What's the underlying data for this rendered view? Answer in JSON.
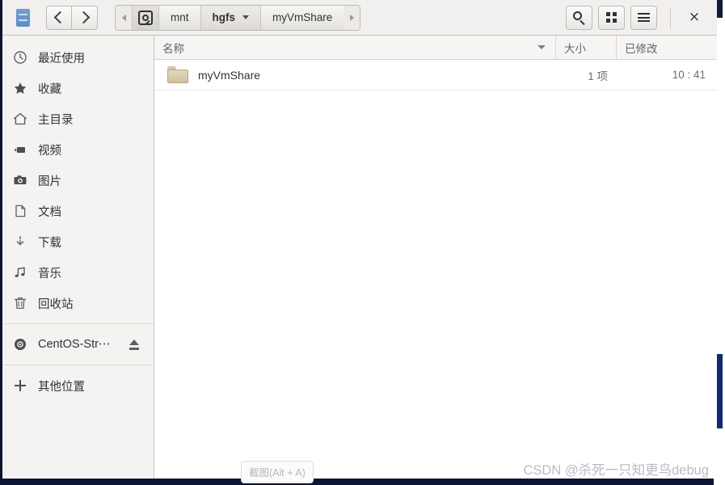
{
  "window": {
    "app_icon": "file-cabinet-icon"
  },
  "header": {
    "nav": {
      "back_label": "‹",
      "forward_label": "›"
    },
    "breadcrumb": {
      "left_arrow": "◂",
      "right_arrow": "▸",
      "items": [
        {
          "label": "",
          "icon": "device-disk-icon",
          "current": false
        },
        {
          "label": "mnt",
          "icon": "",
          "current": false
        },
        {
          "label": "hgfs",
          "icon": "",
          "current": true
        },
        {
          "label": "myVmShare",
          "icon": "",
          "current": false
        }
      ]
    },
    "actions": [
      {
        "name": "search-button",
        "icon": "search-icon"
      },
      {
        "name": "view-grid-button",
        "icon": "grid-icon"
      },
      {
        "name": "main-menu-button",
        "icon": "hamburger-menu-icon"
      }
    ],
    "close_label": "×"
  },
  "sidebar": {
    "items": [
      {
        "label": "最近使用",
        "icon": "clock-icon"
      },
      {
        "label": "收藏",
        "icon": "star-icon"
      },
      {
        "label": "主目录",
        "icon": "home-icon"
      },
      {
        "label": "视频",
        "icon": "video-camera-icon"
      },
      {
        "label": "图片",
        "icon": "camera-icon"
      },
      {
        "label": "文档",
        "icon": "document-icon"
      },
      {
        "label": "下载",
        "icon": "download-icon"
      },
      {
        "label": "音乐",
        "icon": "music-note-icon"
      },
      {
        "label": "回收站",
        "icon": "trash-icon"
      }
    ],
    "devices": [
      {
        "label": "CentOS-Str⋯",
        "icon": "optical-disc-icon",
        "eject": "eject-icon"
      }
    ],
    "other": [
      {
        "label": "其他位置",
        "icon": "plus-icon"
      }
    ]
  },
  "file_list": {
    "columns": [
      {
        "key": "name",
        "label": "名称",
        "sorted": true,
        "sort_dir": "descending"
      },
      {
        "key": "size",
        "label": "大小",
        "sorted": false,
        "sort_dir": ""
      },
      {
        "key": "modified",
        "label": "已修改",
        "sorted": false,
        "sort_dir": ""
      }
    ],
    "rows": [
      {
        "name": "myVmShare",
        "icon": "folder-icon",
        "size": "1 项",
        "modified": "10 : 41"
      }
    ]
  },
  "overlays": {
    "screenshot_tooltip": "截图(Alt + A)",
    "watermark": "CSDN @杀死一只知更鸟debug"
  },
  "colors": {
    "desktop": "#0c1333",
    "headerbar": "#f1f0ee",
    "sidebar": "#f4f3f1",
    "content": "#ffffff",
    "folder": "#d8caa8",
    "app_icon": "#5f93cd"
  }
}
